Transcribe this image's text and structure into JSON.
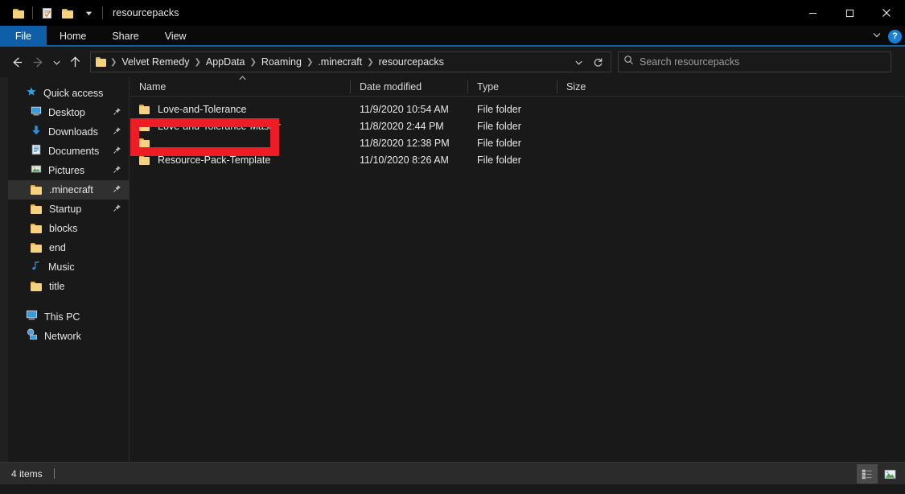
{
  "window": {
    "title": "resourcepacks",
    "quick_access": [
      "folder-icon",
      "properties-icon",
      "new-folder-icon",
      "customize-chevron-icon"
    ],
    "controls": {
      "minimize": "minimize-icon",
      "maximize": "maximize-icon",
      "close": "close-icon"
    }
  },
  "ribbon": {
    "tabs": [
      {
        "label": "File",
        "active": true
      },
      {
        "label": "Home",
        "active": false
      },
      {
        "label": "Share",
        "active": false
      },
      {
        "label": "View",
        "active": false
      }
    ],
    "expand_icon": "chevron-down-icon",
    "help_label": "?"
  },
  "address": {
    "back_icon": "arrow-left-icon",
    "forward_icon": "arrow-right-icon",
    "recent_icon": "chevron-down-icon",
    "up_icon": "arrow-up-icon",
    "breadcrumb": [
      "Velvet Remedy",
      "AppData",
      "Roaming",
      ".minecraft",
      "resourcepacks"
    ],
    "dropdown_icon": "chevron-down-icon",
    "refresh_icon": "refresh-icon"
  },
  "search": {
    "icon": "search-icon",
    "placeholder": "Search resourcepacks",
    "value": ""
  },
  "sidebar": {
    "groups": [
      {
        "header": {
          "label": "Quick access",
          "icon": "star-icon"
        },
        "items": [
          {
            "label": "Desktop",
            "icon": "desktop-icon",
            "pinned": true,
            "selected": false
          },
          {
            "label": "Downloads",
            "icon": "download-icon",
            "pinned": true,
            "selected": false
          },
          {
            "label": "Documents",
            "icon": "document-icon",
            "pinned": true,
            "selected": false
          },
          {
            "label": "Pictures",
            "icon": "pictures-icon",
            "pinned": true,
            "selected": false
          },
          {
            "label": ".minecraft",
            "icon": "folder-icon",
            "pinned": true,
            "selected": true
          },
          {
            "label": "Startup",
            "icon": "folder-icon",
            "pinned": true,
            "selected": false
          },
          {
            "label": "blocks",
            "icon": "folder-icon",
            "pinned": false,
            "selected": false
          },
          {
            "label": "end",
            "icon": "folder-icon",
            "pinned": false,
            "selected": false
          },
          {
            "label": "Music",
            "icon": "music-icon",
            "pinned": false,
            "selected": false
          },
          {
            "label": "title",
            "icon": "folder-icon",
            "pinned": false,
            "selected": false
          }
        ]
      },
      {
        "header": null,
        "items": [
          {
            "label": "This PC",
            "icon": "this-pc-icon",
            "pinned": false,
            "selected": false
          },
          {
            "label": "Network",
            "icon": "network-icon",
            "pinned": false,
            "selected": false
          }
        ]
      }
    ]
  },
  "filelist": {
    "columns": [
      {
        "key": "name",
        "label": "Name",
        "sorted": true,
        "sort_icon": "caret-up-icon"
      },
      {
        "key": "date",
        "label": "Date modified",
        "sorted": false
      },
      {
        "key": "type",
        "label": "Type",
        "sorted": false
      },
      {
        "key": "size",
        "label": "Size",
        "sorted": false
      }
    ],
    "rows": [
      {
        "name": "Love-and-Tolerance",
        "date": "11/9/2020 10:54 AM",
        "type": "File folder",
        "size": "",
        "icon": "folder-icon"
      },
      {
        "name": "Love-and-Tolerance-Master",
        "date": "11/8/2020 2:44 PM",
        "type": "File folder",
        "size": "",
        "icon": "folder-icon"
      },
      {
        "name": "",
        "date": "11/8/2020 12:38 PM",
        "type": "File folder",
        "size": "",
        "icon": "folder-icon"
      },
      {
        "name": "Resource-Pack-Template",
        "date": "11/10/2020 8:26 AM",
        "type": "File folder",
        "size": "",
        "icon": "folder-icon"
      }
    ]
  },
  "annotation": {
    "color": "#ee1c25",
    "shape": "rectangle"
  },
  "statusbar": {
    "item_count": "4 items",
    "views": [
      {
        "name": "details-view",
        "active": true
      },
      {
        "name": "large-icons-view",
        "active": false
      }
    ]
  }
}
